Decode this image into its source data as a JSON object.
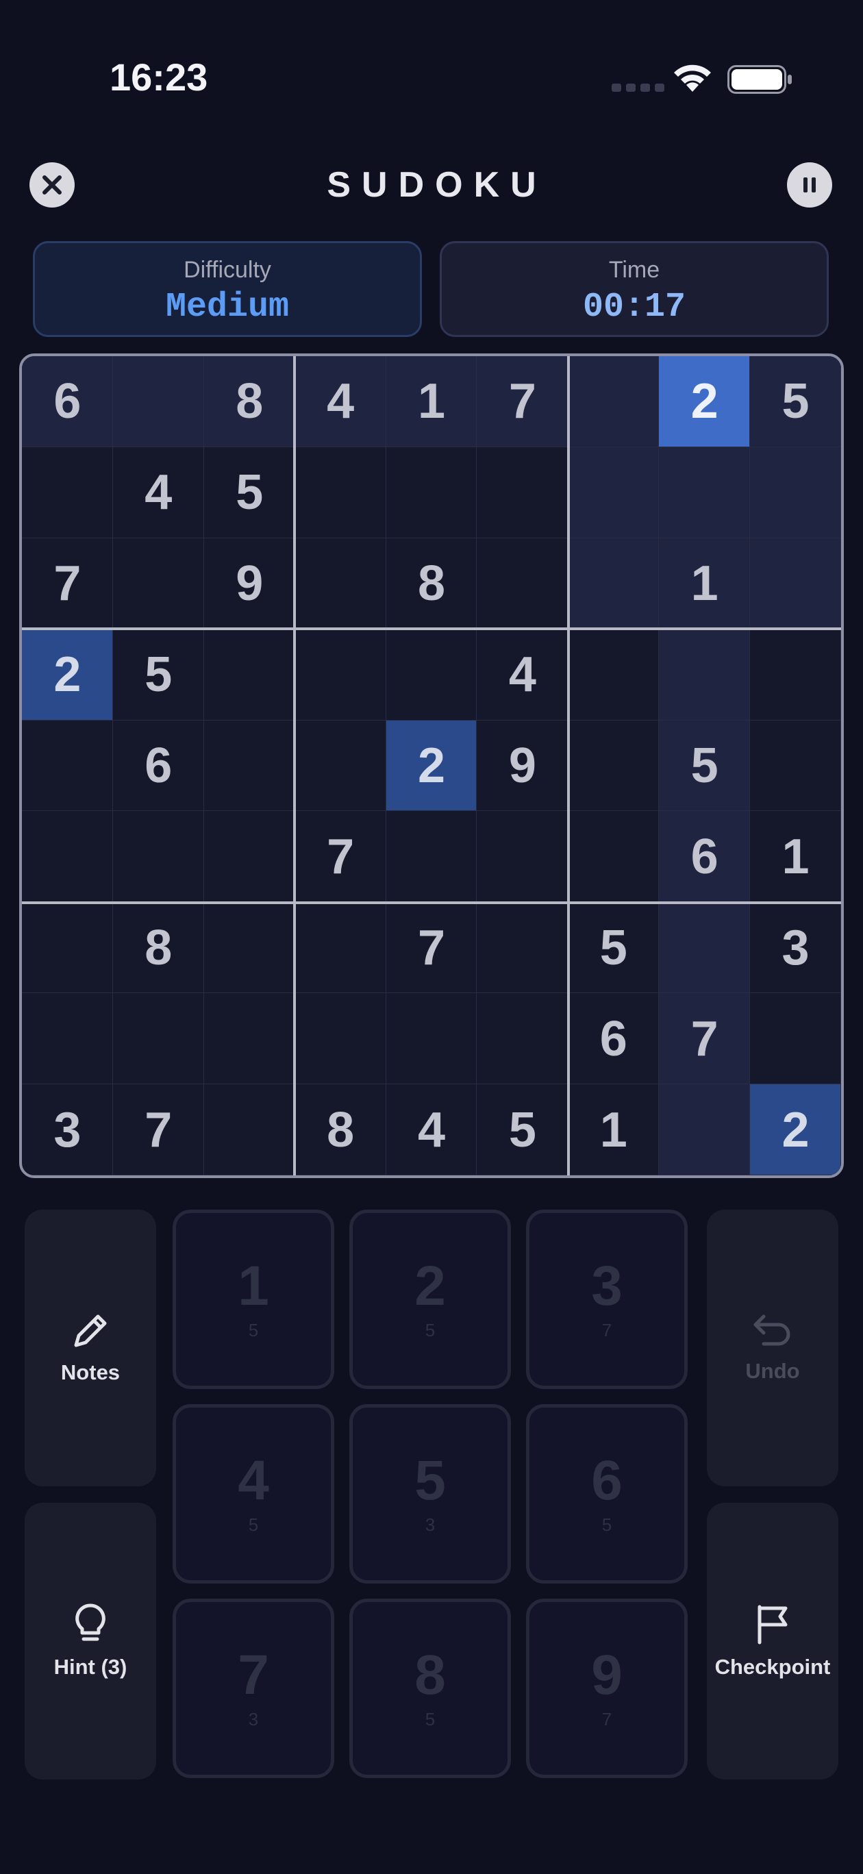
{
  "status": {
    "time": "16:23"
  },
  "header": {
    "title": "SUDOKU"
  },
  "info": {
    "difficulty_label": "Difficulty",
    "difficulty_value": "Medium",
    "time_label": "Time",
    "time_value": "00:17"
  },
  "board": {
    "rows": [
      [
        "6",
        "",
        "8",
        "4",
        "1",
        "7",
        "",
        "2",
        "5"
      ],
      [
        "",
        "4",
        "5",
        "",
        "",
        "",
        "",
        "",
        ""
      ],
      [
        "7",
        "",
        "9",
        "",
        "8",
        "",
        "",
        "1",
        ""
      ],
      [
        "2",
        "5",
        "",
        "",
        "",
        "4",
        "",
        "",
        ""
      ],
      [
        "",
        "6",
        "",
        "",
        "2",
        "9",
        "",
        "5",
        ""
      ],
      [
        "",
        "",
        "",
        "7",
        "",
        "",
        "",
        "6",
        "1"
      ],
      [
        "",
        "8",
        "",
        "",
        "7",
        "",
        "5",
        "",
        "3"
      ],
      [
        "",
        "",
        "",
        "",
        "",
        "",
        "6",
        "7",
        ""
      ],
      [
        "3",
        "7",
        "",
        "8",
        "4",
        "5",
        "1",
        "",
        "2"
      ]
    ],
    "selected": {
      "row": 0,
      "col": 7
    },
    "selected_value": "2"
  },
  "tools": {
    "notes": "Notes",
    "undo": "Undo",
    "hint": "Hint (3)",
    "checkpoint": "Checkpoint"
  },
  "numpad": [
    {
      "digit": "1",
      "remaining": "5"
    },
    {
      "digit": "2",
      "remaining": "5"
    },
    {
      "digit": "3",
      "remaining": "7"
    },
    {
      "digit": "4",
      "remaining": "5"
    },
    {
      "digit": "5",
      "remaining": "3"
    },
    {
      "digit": "6",
      "remaining": "5"
    },
    {
      "digit": "7",
      "remaining": "3"
    },
    {
      "digit": "8",
      "remaining": "5"
    },
    {
      "digit": "9",
      "remaining": "7"
    }
  ],
  "colors": {
    "background": "#0e0f1f",
    "accent": "#5d9cf4",
    "selected_cell": "#3f6cc6",
    "same_value_cell": "#2a4a8c"
  }
}
